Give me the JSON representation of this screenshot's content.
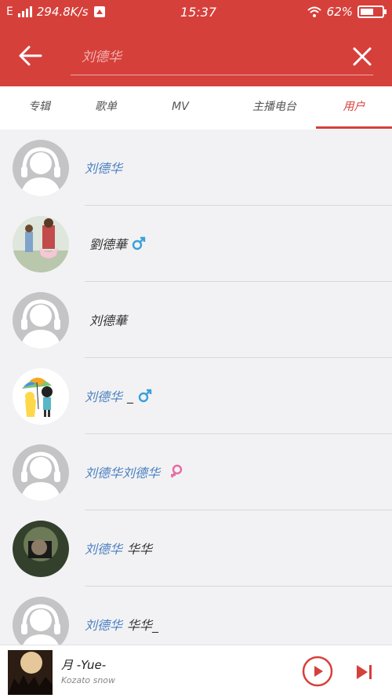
{
  "status": {
    "network": "E",
    "speed": "294.8K/s",
    "time": "15:37",
    "battery": "62%",
    "battery_level": 0.62
  },
  "search": {
    "query": "刘德华"
  },
  "tabs": [
    {
      "label": "专辑"
    },
    {
      "label": "歌单"
    },
    {
      "label": "MV"
    },
    {
      "label": "主播电台"
    },
    {
      "label": "用户"
    }
  ],
  "users": [
    {
      "name_highlight": "刘德华",
      "name_rest": "",
      "gender": "",
      "avatar": "default"
    },
    {
      "name_highlight": "",
      "name_rest": "劉德華",
      "gender": "male",
      "avatar": "photo-couple"
    },
    {
      "name_highlight": "",
      "name_rest": "刘德華",
      "gender": "",
      "avatar": "default"
    },
    {
      "name_highlight": "刘德华",
      "name_rest": "_",
      "gender": "male",
      "avatar": "cartoon-umbrella"
    },
    {
      "name_highlight": "刘德华刘德华",
      "name_rest": "",
      "gender": "female",
      "avatar": "default"
    },
    {
      "name_highlight": "刘德华",
      "name_rest": "华华",
      "gender": "",
      "avatar": "photo-dark"
    },
    {
      "name_highlight": "刘德华",
      "name_rest": "华华_",
      "gender": "",
      "avatar": "default"
    }
  ],
  "player": {
    "song": "月 -Yue-",
    "artist": "Kozato snow"
  },
  "colors": {
    "accent": "#d6403b",
    "highlight": "#4a7fc1",
    "male": "#3aa0d8",
    "female": "#e86aa2"
  },
  "icons": {
    "back": "back-arrow-icon",
    "close": "close-icon",
    "play": "play-icon",
    "next": "next-track-icon"
  }
}
